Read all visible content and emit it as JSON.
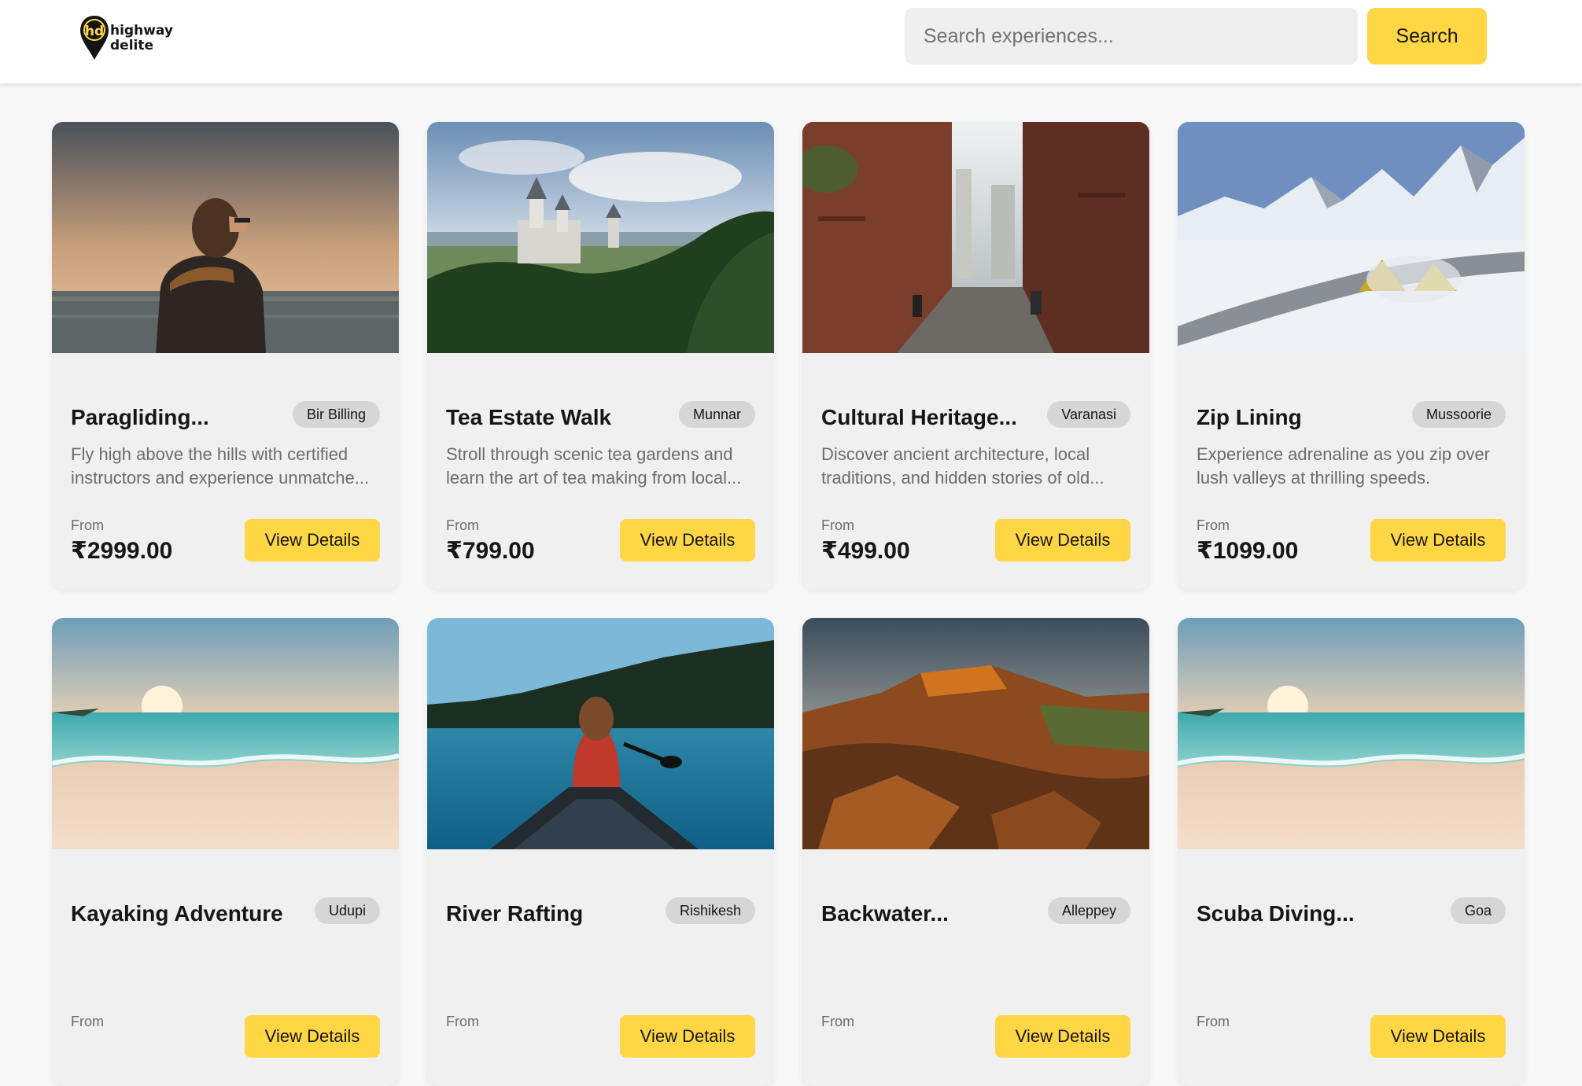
{
  "brand": {
    "logo_text_line1": "highway",
    "logo_text_line2": "delite",
    "mark_text": "hd"
  },
  "search": {
    "placeholder": "Search experiences...",
    "button_label": "Search"
  },
  "labels": {
    "from": "From",
    "view_details": "View Details"
  },
  "colors": {
    "accent": "#ffd643",
    "card_bg": "#f0f0f0",
    "badge_bg": "#d6d6d6"
  },
  "experiences": [
    {
      "title": "Paragliding...",
      "location": "Bir Billing",
      "description": "Fly high above the hills with certified instructors and experience unmatche...",
      "price": "₹2999.00",
      "image": "person-overlooking-sea-photo"
    },
    {
      "title": "Tea Estate Walk",
      "location": "Munnar",
      "description": "Stroll through scenic tea gardens and learn the art of tea making from local...",
      "price": "₹799.00",
      "image": "castle-forest-photo"
    },
    {
      "title": "Cultural Heritage...",
      "location": "Varanasi",
      "description": "Discover ancient architecture, local traditions, and hidden stories of old...",
      "price": "₹499.00",
      "image": "brick-alley-photo"
    },
    {
      "title": "Zip Lining",
      "location": "Mussoorie",
      "description": "Experience adrenaline as you zip over lush valleys at thrilling speeds.",
      "price": "₹1099.00",
      "image": "snowy-mountains-photo"
    },
    {
      "title": "Kayaking Adventure",
      "location": "Udupi",
      "description": "",
      "price": "",
      "image": "beach-sunset-photo"
    },
    {
      "title": "River Rafting",
      "location": "Rishikesh",
      "description": "",
      "price": "",
      "image": "canoe-lake-photo"
    },
    {
      "title": "Backwater...",
      "location": "Alleppey",
      "description": "",
      "price": "",
      "image": "red-cliff-photo"
    },
    {
      "title": "Scuba Diving...",
      "location": "Goa",
      "description": "",
      "price": "",
      "image": "beach-sunset-photo"
    }
  ]
}
